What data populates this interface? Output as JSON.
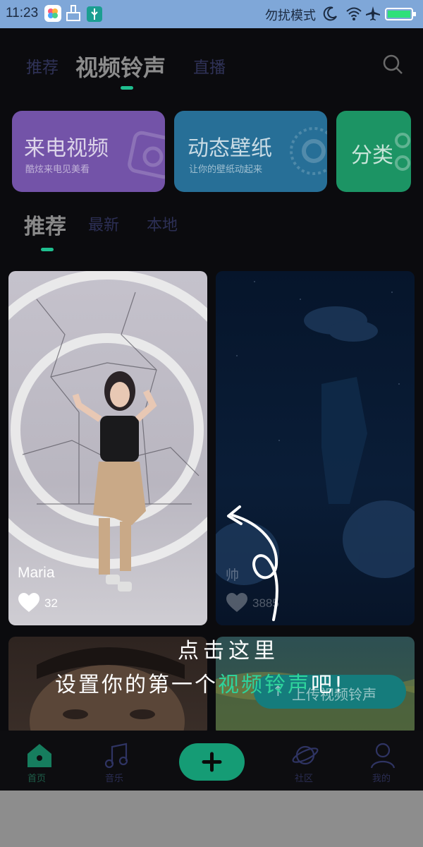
{
  "status_bar": {
    "time": "11:23",
    "dnd_text": "勿扰模式"
  },
  "header": {
    "tabs": [
      {
        "label": "推荐"
      },
      {
        "label": "视频铃声"
      },
      {
        "label": "直播"
      }
    ],
    "accent": "#1fbf8f"
  },
  "feature_cards": [
    {
      "title": "来电视频",
      "subtitle": "酷炫来电见美看",
      "color": "#7b57b0"
    },
    {
      "title": "动态壁纸",
      "subtitle": "让你的壁纸动起来",
      "color": "#2c78a3"
    },
    {
      "title": "分类",
      "subtitle": "",
      "color": "#1f9c6a"
    }
  ],
  "sub_tabs": [
    {
      "label": "推荐"
    },
    {
      "label": "最新"
    },
    {
      "label": "本地"
    }
  ],
  "videos": [
    {
      "title": "Maria",
      "likes": "32"
    },
    {
      "title": "帅",
      "likes": "3885"
    }
  ],
  "upload_button": {
    "label": "上传视频铃声"
  },
  "guide": {
    "line1": "点击这里",
    "line2_prefix": "设置你的第一个",
    "line2_highlight": "视频铃声",
    "line2_suffix": "吧!",
    "highlight_color": "#2ed39b"
  },
  "bottom_nav": [
    {
      "label": "首页",
      "icon": "home-icon"
    },
    {
      "label": "音乐",
      "icon": "music-note-icon"
    },
    {
      "label": "",
      "icon": "plus-icon"
    },
    {
      "label": "社区",
      "icon": "planet-icon"
    },
    {
      "label": "我的",
      "icon": "person-icon"
    }
  ]
}
